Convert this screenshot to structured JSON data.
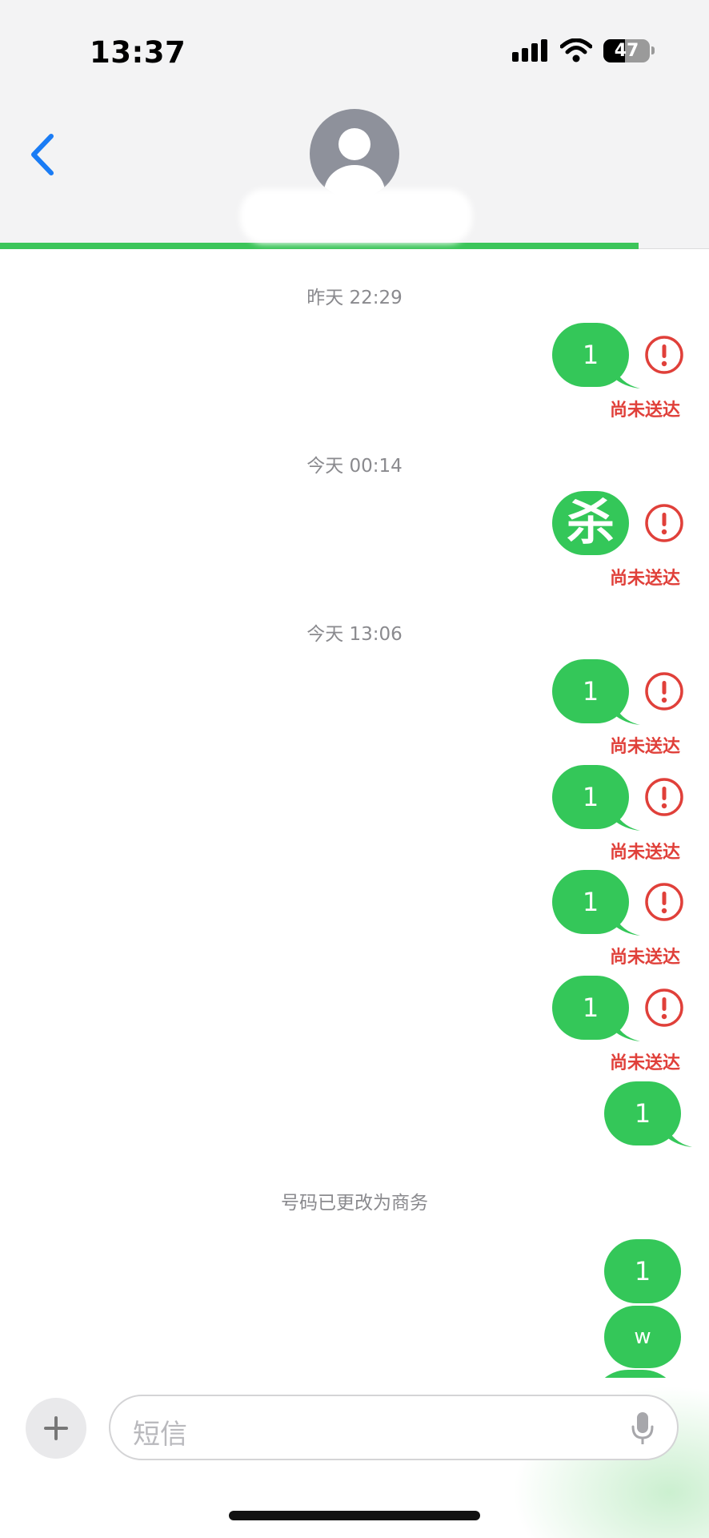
{
  "status_bar": {
    "time": "13:37",
    "battery_level": "47",
    "battery_fraction": 0.47
  },
  "icons": [
    "back-chevron-icon",
    "avatar-person-icon",
    "cellular-signal-icon",
    "wifi-icon",
    "battery-icon",
    "error-icon",
    "plus-icon",
    "microphone-icon"
  ],
  "colors": {
    "bubble": "#34c759",
    "error": "#e0403a",
    "back": "#1a7cf5",
    "progress": "#3cc55a"
  },
  "conversation": {
    "timestamps": [
      "昨天 22:29",
      "今天 00:14",
      "今天 13:06"
    ],
    "undelivered_label": "尚未送达",
    "messages": [
      {
        "text": "1",
        "failed": true
      },
      {
        "text": "杀",
        "failed": true
      },
      {
        "text": "1",
        "failed": true
      },
      {
        "text": "1",
        "failed": true
      },
      {
        "text": "1",
        "failed": true
      },
      {
        "text": "1",
        "failed": true
      },
      {
        "text": "1",
        "failed": false
      },
      {
        "text": "1",
        "failed": false
      },
      {
        "text": "w",
        "failed": false
      }
    ],
    "notice": "号码已更改为商务"
  },
  "composer": {
    "placeholder": "短信"
  }
}
